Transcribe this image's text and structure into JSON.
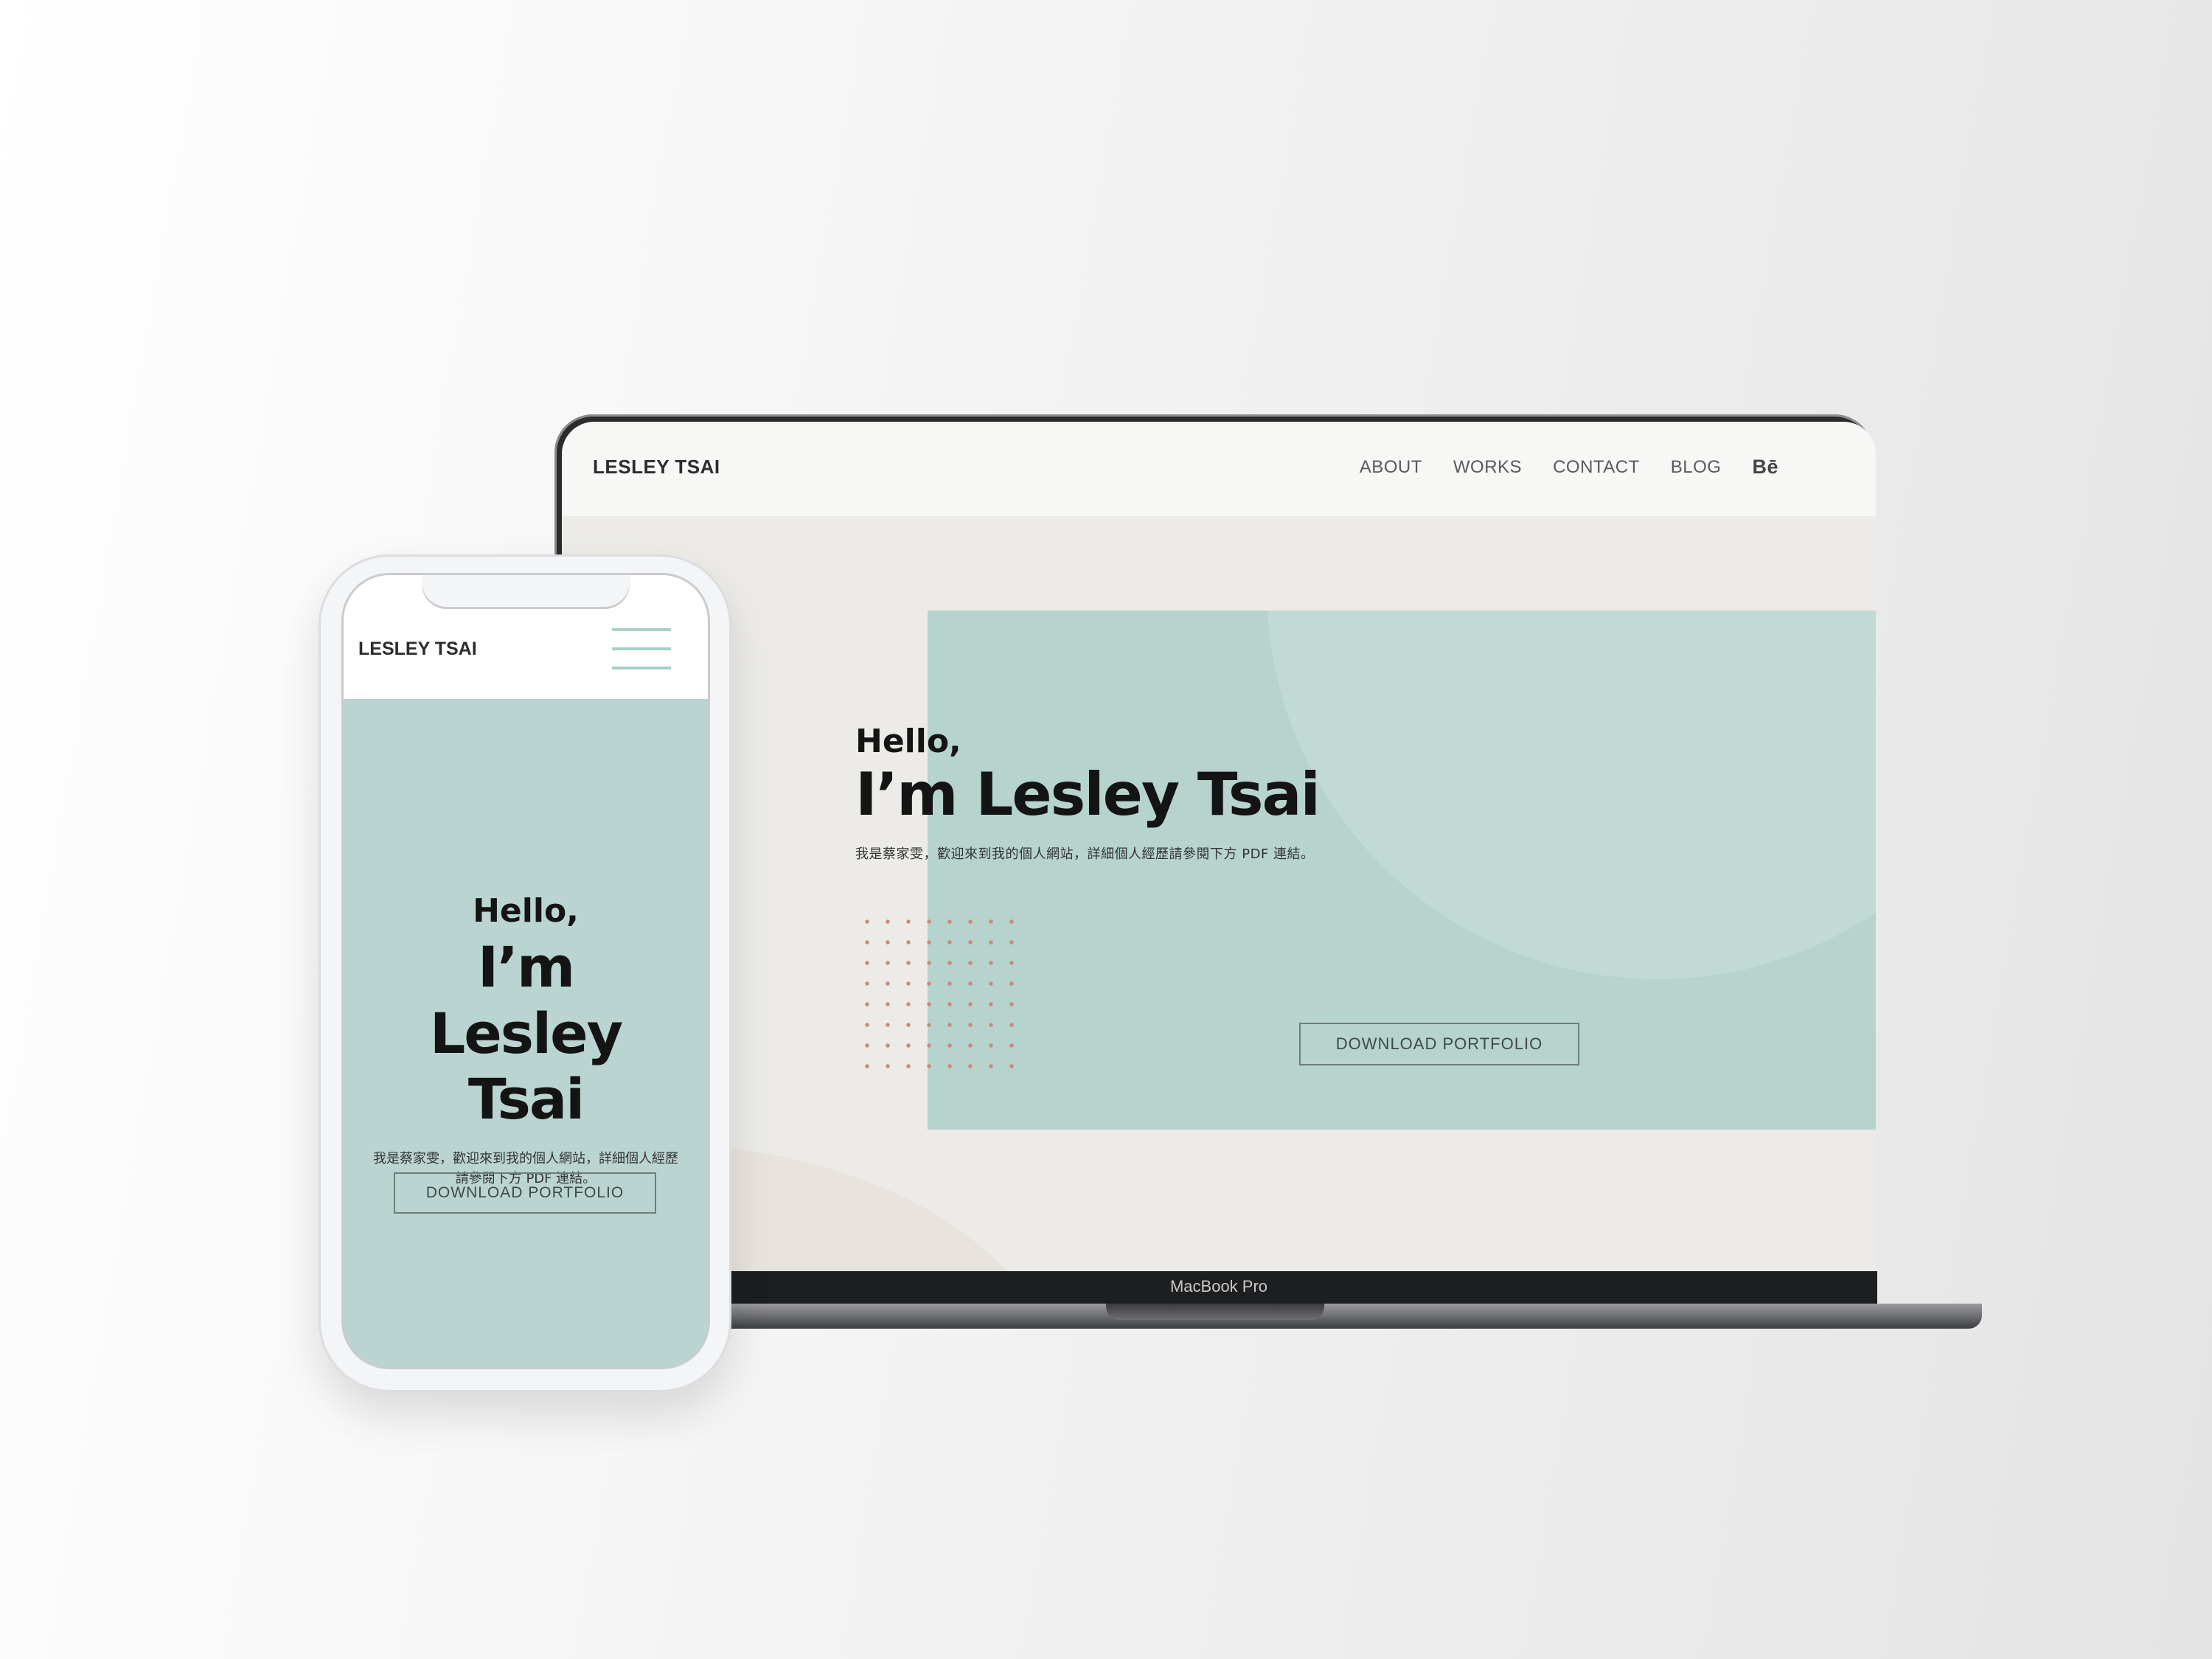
{
  "site": {
    "brand": "LESLEY TSAI",
    "nav": [
      "ABOUT",
      "WORKS",
      "CONTACT",
      "BLOG",
      "Bē"
    ],
    "hero": {
      "greeting": "Hello,",
      "name": "I’m Lesley Tsai",
      "description": "我是蔡家雯，歡迎來到我的個人網站，詳細個人經歷請參閱下方 PDF 連結。",
      "cta": "DOWNLOAD PORTFOLIO"
    }
  },
  "mobile": {
    "brand": "LESLEY TSAI",
    "greeting": "Hello,",
    "name": "I’m Lesley Tsai",
    "description": "我是蔡家雯，歡迎來到我的個人網站，詳細個人經歷請參閱下方 PDF 連結。",
    "cta": "DOWNLOAD PORTFOLIO",
    "menu_icon": "hamburger-menu-icon"
  },
  "device": {
    "laptop_label": "MacBook Pro"
  },
  "colors": {
    "accent_mint": "#b6d3ce",
    "dot_accent": "#c88a7d",
    "page_bg": "#ecebe7",
    "text_dark": "#141414"
  }
}
